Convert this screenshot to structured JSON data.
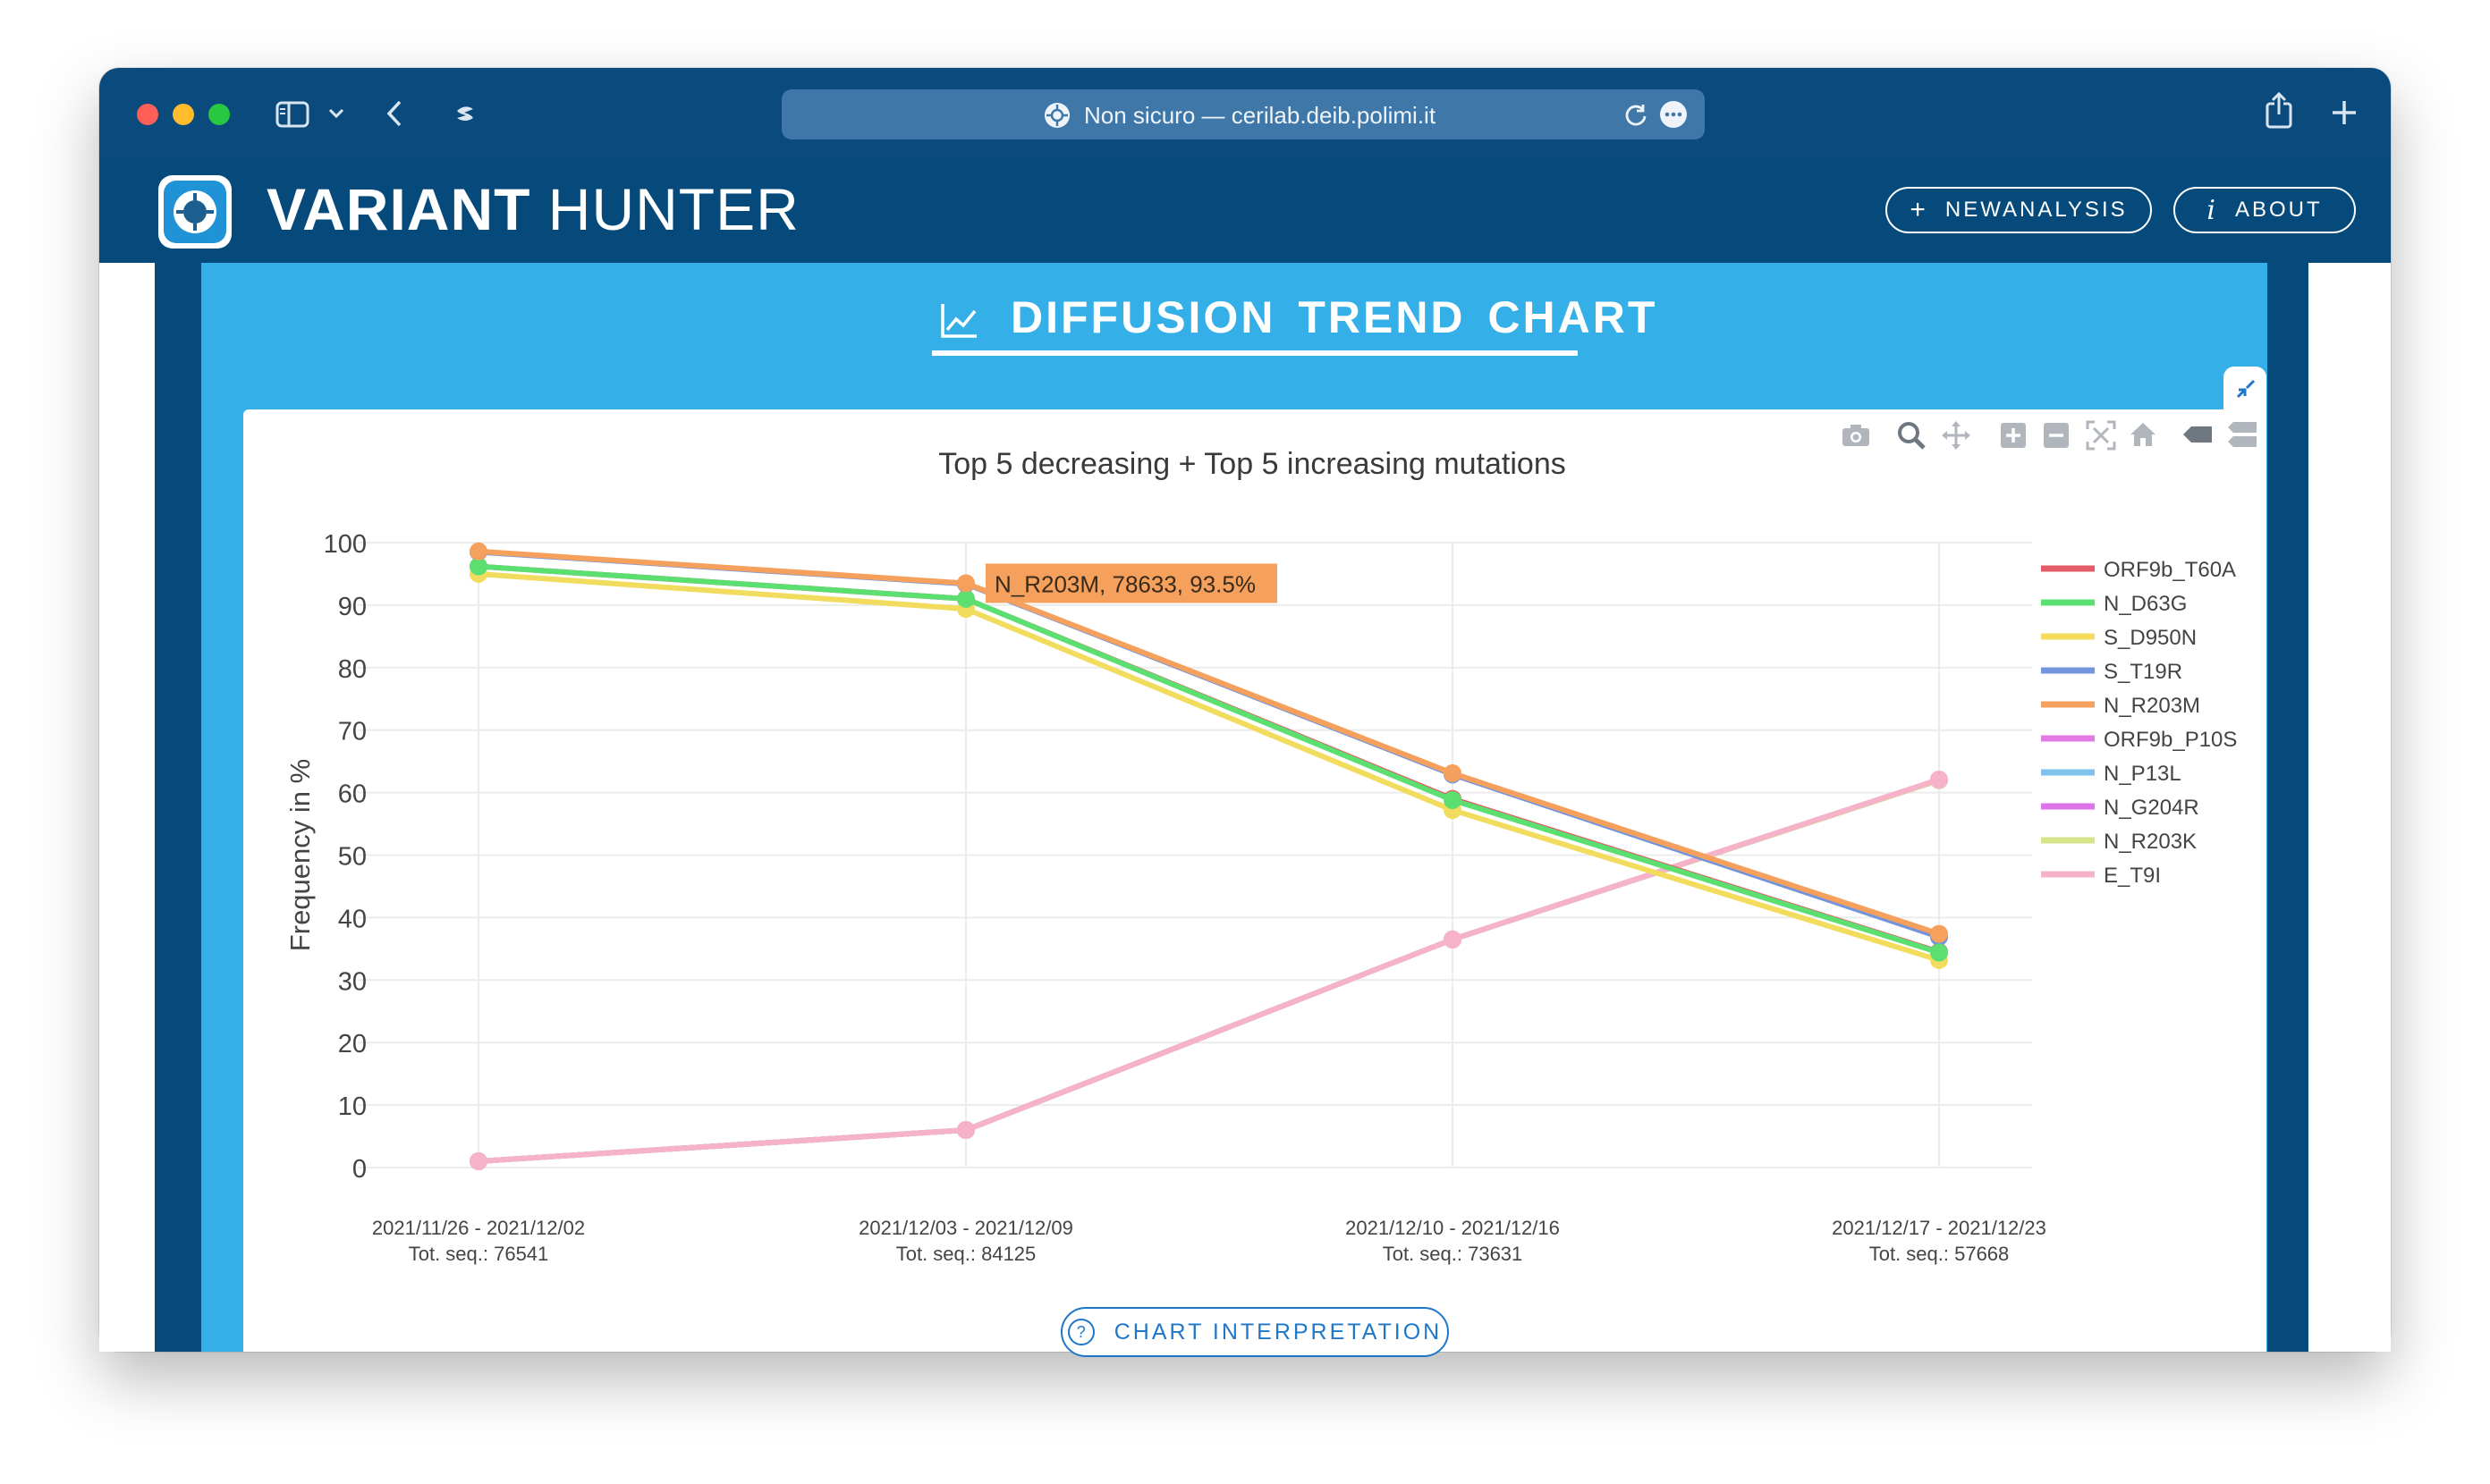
{
  "browser": {
    "url_text": "Non sicuro — cerilab.deib.polimi.it",
    "traffic_colors": [
      "#fe5f57",
      "#febc2e",
      "#28c840"
    ]
  },
  "app": {
    "brand_bold": "VARIANT",
    "brand_light": "HUNTER",
    "new_analysis_label": "NEWANALYSIS",
    "about_label": "ABOUT"
  },
  "panel": {
    "title": "DIFFUSION TREND CHART",
    "interpretation_label": "CHART INTERPRETATION"
  },
  "chart_data": {
    "type": "line",
    "title": "Top 5 decreasing + Top 5 increasing mutations",
    "xlabel": "",
    "ylabel": "Frequency in %",
    "ylim": [
      0,
      100
    ],
    "yticks": [
      0,
      10,
      20,
      30,
      40,
      50,
      60,
      70,
      80,
      90,
      100
    ],
    "categories": [
      "2021/11/26 - 2021/12/02",
      "2021/12/03 - 2021/12/09",
      "2021/12/10 - 2021/12/16",
      "2021/12/17 - 2021/12/23"
    ],
    "category_subtitles": [
      "Tot. seq.: 76541",
      "Tot. seq.: 84125",
      "Tot. seq.: 73631",
      "Tot. seq.: 57668"
    ],
    "grid": true,
    "legend_position": "right",
    "series": [
      {
        "name": "ORF9b_T60A",
        "color": "#e45c65",
        "values": [
          96.2,
          91.0,
          59.0,
          34.5
        ]
      },
      {
        "name": "N_D63G",
        "color": "#5cdf71",
        "values": [
          96.2,
          91.0,
          58.8,
          34.4
        ]
      },
      {
        "name": "S_D950N",
        "color": "#f2dc5d",
        "values": [
          95.0,
          89.4,
          57.2,
          33.2
        ]
      },
      {
        "name": "S_T19R",
        "color": "#7294dc",
        "values": [
          98.5,
          93.4,
          62.9,
          36.9
        ]
      },
      {
        "name": "N_R203M",
        "color": "#f5a15d",
        "values": [
          98.6,
          93.5,
          63.1,
          37.4
        ]
      },
      {
        "name": "ORF9b_P10S",
        "color": "#e47ae4",
        "values": [
          1.0,
          6.0,
          36.5,
          62.0
        ]
      },
      {
        "name": "N_P13L",
        "color": "#7dc3ec",
        "values": [
          1.0,
          6.0,
          36.5,
          62.0
        ]
      },
      {
        "name": "N_G204R",
        "color": "#dc73e6",
        "values": [
          1.0,
          6.0,
          36.5,
          62.0
        ]
      },
      {
        "name": "N_R203K",
        "color": "#d5e58a",
        "values": [
          1.0,
          6.0,
          36.5,
          62.0
        ]
      },
      {
        "name": "E_T9I",
        "color": "#f5b2c8",
        "values": [
          1.0,
          6.0,
          36.5,
          62.1
        ]
      }
    ],
    "hover_label": "N_R203M, 78633, 93.5%",
    "hover_color": "#f5a15d"
  }
}
